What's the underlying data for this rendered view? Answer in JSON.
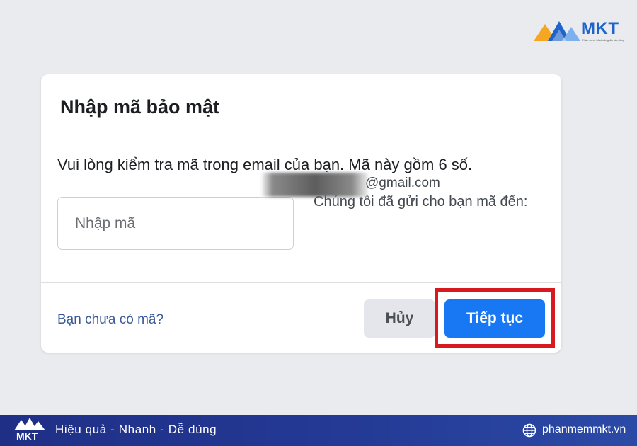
{
  "brand": {
    "logo_text": "MKT",
    "logo_tagline": "Phần mềm Marketing đa nền tảng",
    "colors": {
      "orange": "#f5a623",
      "blue": "#1f64c8"
    }
  },
  "dialog": {
    "title": "Nhập mã bảo mật",
    "instruction": "Vui lòng kiểm tra mã trong email của bạn. Mã này gồm 6 số.",
    "code_input": {
      "placeholder": "Nhập mã",
      "value": ""
    },
    "sent_note": "Chúng tôi đã gửi cho bạn mã đến:",
    "email_visible": "@gmail.com",
    "no_code_link": "Bạn chưa có mã?",
    "cancel_label": "Hủy",
    "continue_label": "Tiếp tục",
    "colors": {
      "primary": "#1877f2",
      "highlight": "#d71920"
    }
  },
  "footer": {
    "logo_text": "MKT",
    "slogan": "Hiệu quả - Nhanh - Dễ dùng",
    "website": "phanmemmkt.vn",
    "icon": "globe-icon"
  }
}
